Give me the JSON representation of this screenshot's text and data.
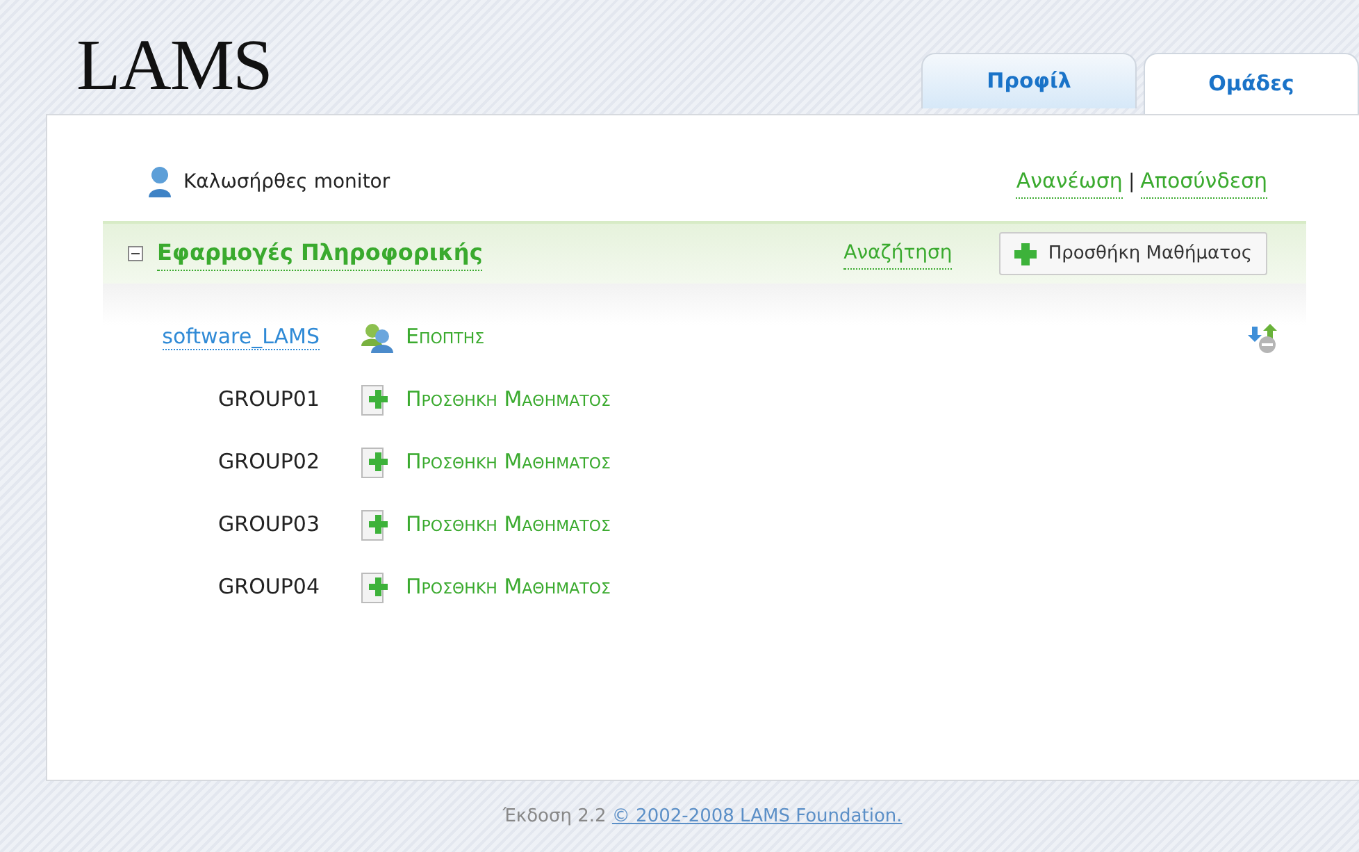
{
  "logo": "LAMS",
  "tabs": [
    {
      "label": "Προφίλ",
      "selected": false
    },
    {
      "label": "Ομάδες",
      "selected": true
    }
  ],
  "welcome": "Καλωσήρθες monitor",
  "links": [
    "Ανανέωση",
    "Αποσύνδεση"
  ],
  "link_separator": "|",
  "course": {
    "title": "Εφαρμογές Πληροφορικής",
    "expanded": true,
    "search_link": "Αναζήτηση",
    "add_button": "Προσθήκη Μαθήματος",
    "name": "software_LAMS",
    "role": "Εποπτης",
    "groups": [
      {
        "name": "GROUP01",
        "action": "Προσθηκη Μαθηματος"
      },
      {
        "name": "GROUP02",
        "action": "Προσθηκη Μαθηματος"
      },
      {
        "name": "GROUP03",
        "action": "Προσθηκη Μαθηματος"
      },
      {
        "name": "GROUP04",
        "action": "Προσθηκη Μαθηματος"
      }
    ]
  },
  "footer": {
    "version": "Έκδοση 2.2",
    "copyright": "© 2002-2008 LAMS Foundation."
  }
}
